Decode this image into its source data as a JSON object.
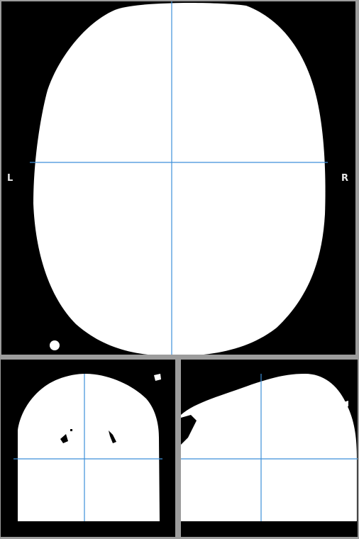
{
  "viewer": {
    "crosshair_color": "#3d8fd9",
    "mask_color": "#ffffff",
    "background_color": "#000000",
    "axial": {
      "orientation_left": "L",
      "orientation_right": "R"
    }
  }
}
